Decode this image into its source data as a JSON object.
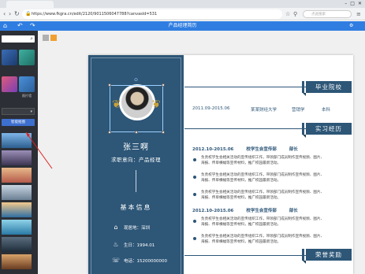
{
  "browser": {
    "url": "https://www.fkgra.cn/edit/2120/9011506047788?canvasId=531",
    "search_placeholder": "点此搜索"
  },
  "toolbar": {
    "doc_title": "产品经理简历"
  },
  "left_panel": {
    "labels": [
      "",
      "",
      "",
      "照片墙"
    ],
    "button_label": "智能抠图"
  },
  "resume": {
    "name": "张三啊",
    "intent": "求职意向：产品经理",
    "basic_title": "基本信息",
    "info": [
      {
        "icon": "home-icon",
        "text": "现居地：深圳"
      },
      {
        "icon": "cake-icon",
        "text": "生日：1994.01"
      },
      {
        "icon": "phone-icon",
        "text": "电话：15200000000"
      }
    ],
    "sections": {
      "education": "毕业院校",
      "experience": "实习经历",
      "honors": "荣誉奖励"
    },
    "education": {
      "period": "2011.09-2015.06",
      "school": "某某财经大学",
      "major": "营销学",
      "degree": "本科"
    },
    "experience": [
      {
        "period": "2012.10-2015.06",
        "org": "校学生会宣传部",
        "role": "部长",
        "bullets": [
          "负责校学生会相关活动的宣传组织工作，带领部门成员制作宣传视频、图片、海报、传单横幅等宣传材料，推广校园最新活动。",
          "负责校学生会相关活动的宣传组织工作，带领部门成员制作宣传视频、图片、海报、传单横幅等宣传材料，推广校园最新活动。",
          "负责校学生会相关活动的宣传组织工作，带领部门成员制作宣传视频、图片、海报、传单横幅等宣传材料，推广校园最新活动。"
        ]
      },
      {
        "period": "2012.10-2015.06",
        "org": "校学生会宣传部",
        "role": "部长",
        "bullets": [
          "负责校学生会相关活动的宣传组织工作，带领部门成员制作宣传视频、图片、海报、传单横幅等宣传材料，推广校园最新活动。",
          "负责校学生会相关活动的宣传组织工作，带领部门成员制作宣传视频、图片、海报、传单横幅等宣传材料，推广校园最新活动。"
        ]
      }
    ]
  },
  "colors": {
    "accent": "#2d5677",
    "toolbar": "#2f7de1",
    "panel": "#2c2f36",
    "laurel": "#c9a13b",
    "arrow": "#e02020"
  }
}
